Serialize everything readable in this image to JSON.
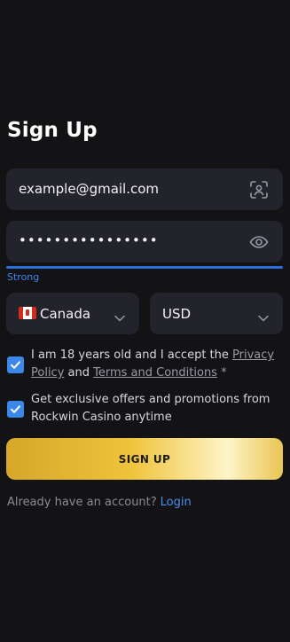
{
  "title": "Sign Up",
  "email": {
    "value": "example@gmail.com",
    "icon": "face-scan-icon"
  },
  "password": {
    "value": "••••••••••••••••",
    "icon": "eye-icon"
  },
  "strength": {
    "label": "Strong",
    "level": 1.0,
    "color": "#2d6fd8"
  },
  "country": {
    "value": "Canada",
    "flag": "canada-flag-icon"
  },
  "currency": {
    "value": "USD"
  },
  "terms": {
    "checked": true,
    "prefix": "I am 18 years old and I accept the ",
    "privacy_link": "Privacy Policy",
    "and": " and ",
    "terms_link": "Terms and Conditions",
    "required_mark": " *"
  },
  "offers": {
    "checked": true,
    "text": "Get exclusive offers and promotions from Rockwin Casino anytime"
  },
  "signup_button": "SIGN UP",
  "footer": {
    "prompt": "Already have an account?",
    "login_link": "Login"
  },
  "colors": {
    "accent": "#3b87ea",
    "background": "#131316",
    "field": "#23232b"
  }
}
